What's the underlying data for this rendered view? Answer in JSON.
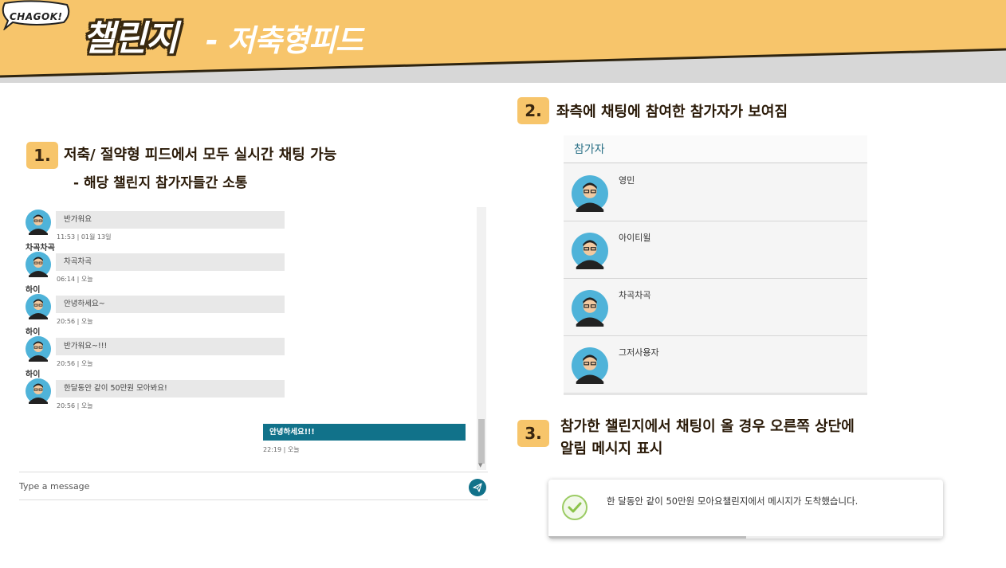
{
  "banner": {
    "logo": "CHAGOK!",
    "title": "챌린지",
    "subtitle": "- 저축형피드"
  },
  "steps": [
    {
      "number": "1.",
      "lines": [
        "저축/ 절약형 피드에서 모두 실시간 채팅 가능",
        "- 해당 챌린지 참가자들간 소통"
      ]
    },
    {
      "number": "2.",
      "lines": [
        "좌측에 채팅에 참여한 참가자가 보여짐"
      ]
    },
    {
      "number": "3.",
      "lines": [
        "참가한 챌린지에서 채팅이 올 경우 오른쪽 상단에",
        "알림 메시지 표시"
      ]
    }
  ],
  "chat": {
    "messages": [
      {
        "sender": "",
        "text": "반가워요",
        "time": "11:53 | 01월 13일"
      },
      {
        "sender": "차곡차곡",
        "text": "차곡차곡",
        "time": "06:14 | 오늘"
      },
      {
        "sender": "하이",
        "text": "안녕하세요~",
        "time": "20:56 | 오늘"
      },
      {
        "sender": "하이",
        "text": "반가워요~!!!",
        "time": "20:56 | 오늘"
      },
      {
        "sender": "하이",
        "text": "한달동안 같이 50만원 모아봐요!",
        "time": "20:56 | 오늘"
      }
    ],
    "my_message": {
      "text": "안녕하세요!!!",
      "time": "22:19 | 오늘"
    },
    "input_placeholder": "Type a message",
    "send_icon": "send-icon"
  },
  "participants": {
    "title": "참가자",
    "items": [
      "영민",
      "아이티윌",
      "차곡차곡",
      "그저사용자"
    ]
  },
  "toast": {
    "icon": "check-circle-icon",
    "message": "한 달동안 같이 50만원 모아요챌린지에서 메시지가 도착했습니다.",
    "progress": 0.5
  },
  "colors": {
    "banner": "#f7c56b",
    "accent": "#11728a",
    "step_badge": "#f7c56b",
    "success": "#8bc34a"
  }
}
